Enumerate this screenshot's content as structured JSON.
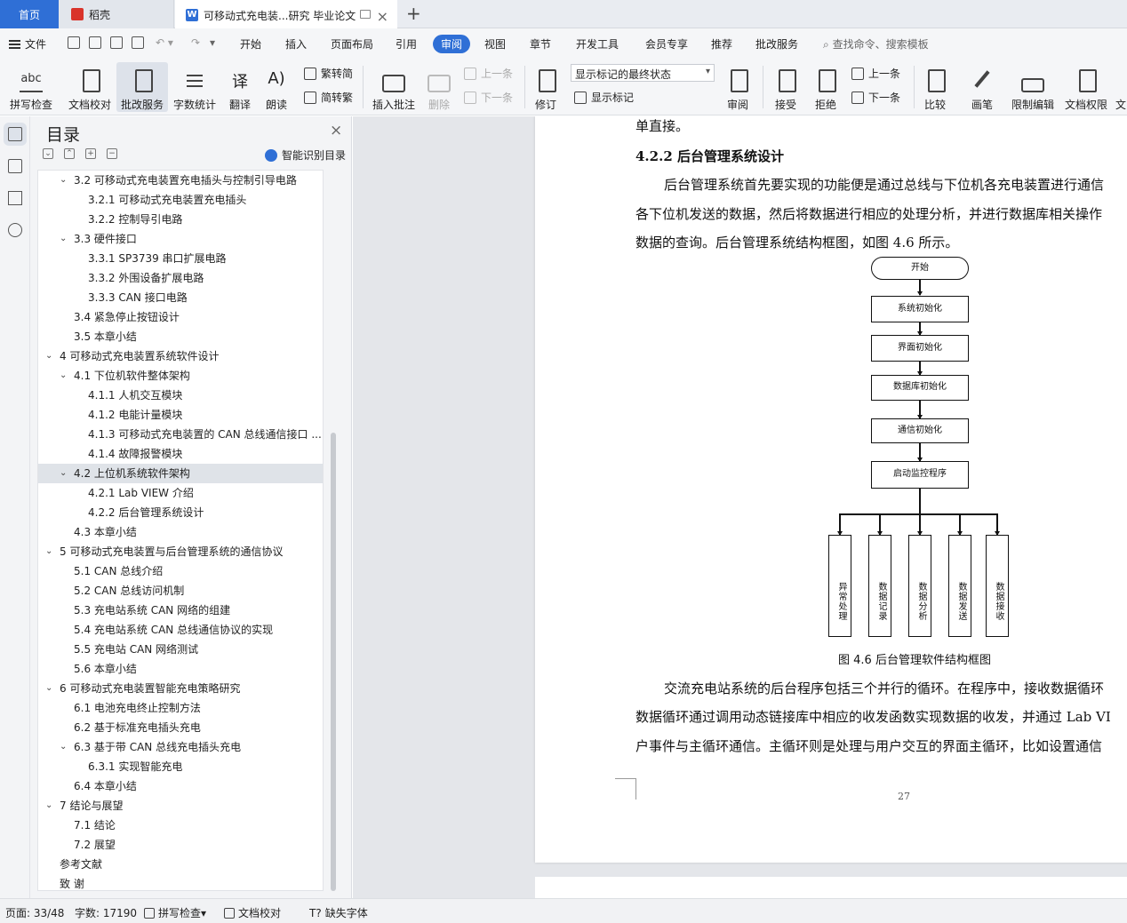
{
  "tabs": {
    "home": "首页",
    "daoke": "稻壳",
    "doc": "可移动式充电装...研究 毕业论文"
  },
  "menu": {
    "file": "文件",
    "items": [
      "开始",
      "插入",
      "页面布局",
      "引用",
      "审阅",
      "视图",
      "章节",
      "开发工具",
      "会员专享",
      "推荐",
      "批改服务"
    ],
    "active": "审阅",
    "search": "查找命令、搜索模板"
  },
  "ribbon": {
    "spell_check": "拼写检查",
    "doc_proof": "文档校对",
    "review_service": "批改服务",
    "word_count": "字数统计",
    "translate": "翻译",
    "read_aloud": "朗读",
    "trad_to_simp": "繁转简",
    "simp_to_trad": "简转繁",
    "insert_comment": "插入批注",
    "delete": "删除",
    "prev_comment": "上一条",
    "next_comment": "下一条",
    "revise": "修订",
    "markup_state": "显示标记的最终状态",
    "show_markup": "显示标记",
    "review_pane": "审阅",
    "accept": "接受",
    "reject": "拒绝",
    "prev_change": "上一条",
    "next_change": "下一条",
    "compare": "比较",
    "ink": "画笔",
    "restrict_edit": "限制编辑",
    "doc_permission": "文档权限",
    "doc_more": "文"
  },
  "toc": {
    "title": "目录",
    "smart": "智能识别目录",
    "items": [
      {
        "text": "3.2  可移动式充电装置充电插头与控制引导电路",
        "level": 2,
        "exp": true
      },
      {
        "text": "3.2.1  可移动式充电装置充电插头",
        "level": 3
      },
      {
        "text": "3.2.2  控制导引电路",
        "level": 3
      },
      {
        "text": "3.3  硬件接口",
        "level": 2,
        "exp": true
      },
      {
        "text": "3.3.1 SP3739 串口扩展电路",
        "level": 3
      },
      {
        "text": "3.3.2  外围设备扩展电路",
        "level": 3
      },
      {
        "text": "3.3.3 CAN 接口电路",
        "level": 3
      },
      {
        "text": "3.4  紧急停止按钮设计",
        "level": 2
      },
      {
        "text": "3.5  本章小结",
        "level": 2
      },
      {
        "text": "4  可移动式充电装置系统软件设计",
        "level": 1,
        "exp": true
      },
      {
        "text": "4.1 下位机软件整体架构",
        "level": 2,
        "exp": true
      },
      {
        "text": "4.1.1  人机交互模块",
        "level": 3
      },
      {
        "text": "4.1.2  电能计量模块",
        "level": 3
      },
      {
        "text": "4.1.3 可移动式充电装置的 CAN 总线通信接口 ...",
        "level": 3
      },
      {
        "text": "4.1.4 故障报警模块",
        "level": 3
      },
      {
        "text": "4.2 上位机系统软件架构",
        "level": 2,
        "exp": true,
        "sel": true
      },
      {
        "text": "4.2.1 Lab VIEW 介绍",
        "level": 3
      },
      {
        "text": "4.2.2 后台管理系统设计",
        "level": 3
      },
      {
        "text": "4.3 本章小结",
        "level": 2
      },
      {
        "text": "5  可移动式充电装置与后台管理系统的通信协议",
        "level": 1,
        "exp": true
      },
      {
        "text": "5.1 CAN 总线介绍",
        "level": 2
      },
      {
        "text": "5.2 CAN 总线访问机制",
        "level": 2
      },
      {
        "text": "5.3  充电站系统 CAN 网络的组建",
        "level": 2
      },
      {
        "text": "5.4  充电站系统 CAN 总线通信协议的实现",
        "level": 2
      },
      {
        "text": "5.5  充电站 CAN 网络测试",
        "level": 2
      },
      {
        "text": "5.6  本章小结",
        "level": 2
      },
      {
        "text": "6  可移动式充电装置智能充电策略研究",
        "level": 1,
        "exp": true
      },
      {
        "text": "6.1  电池充电终止控制方法",
        "level": 2
      },
      {
        "text": "6.2  基于标准充电插头充电",
        "level": 2
      },
      {
        "text": "6.3  基于带 CAN 总线充电插头充电",
        "level": 2,
        "exp": true
      },
      {
        "text": "6.3.1 实现智能充电",
        "level": 3
      },
      {
        "text": "6.4  本章小结",
        "level": 2
      },
      {
        "text": "7  结论与展望",
        "level": 1,
        "exp": true
      },
      {
        "text": "7.1  结论",
        "level": 2
      },
      {
        "text": "7.2  展望",
        "level": 2
      },
      {
        "text": "参考文献",
        "level": 0
      },
      {
        "text": "致    谢",
        "level": 0
      }
    ]
  },
  "document": {
    "line0": "单直接。",
    "heading": "4.2.2 后台管理系统设计",
    "p1_l1": "后台管理系统首先要实现的功能便是通过总线与下位机各充电装置进行通信",
    "p1_l2": "各下位机发送的数据，然后将数据进行相应的处理分析，并进行数据库相关操作",
    "p1_l3": "数据的查询。后台管理系统结构框图，如图 4.6 所示。",
    "flow": {
      "start": "开始",
      "sys_init": "系统初始化",
      "ui_init": "界面初始化",
      "db_init": "数据库初始化",
      "comm_init": "通信初始化",
      "monitor": "启动监控程序",
      "branches": [
        "异常处理",
        "数据记录",
        "数据分析",
        "数据发送",
        "数据接收"
      ]
    },
    "caption": "图 4.6 后台管理软件结构框图",
    "p2_l1": "交流充电站系统的后台程序包括三个并行的循环。在程序中，接收数据循环",
    "p2_l2": "数据循环通过调用动态链接库中相应的收发函数实现数据的收发，并通过 Lab VI",
    "p2_l3": "户事件与主循环通信。主循环则是处理与用户交互的界面主循环，比如设置通信",
    "page_number": "27"
  },
  "status": {
    "page": "页面: 33/48",
    "words": "字数: 17190",
    "spell": "拼写检查",
    "proof": "文档校对",
    "missing_font": "缺失字体"
  }
}
